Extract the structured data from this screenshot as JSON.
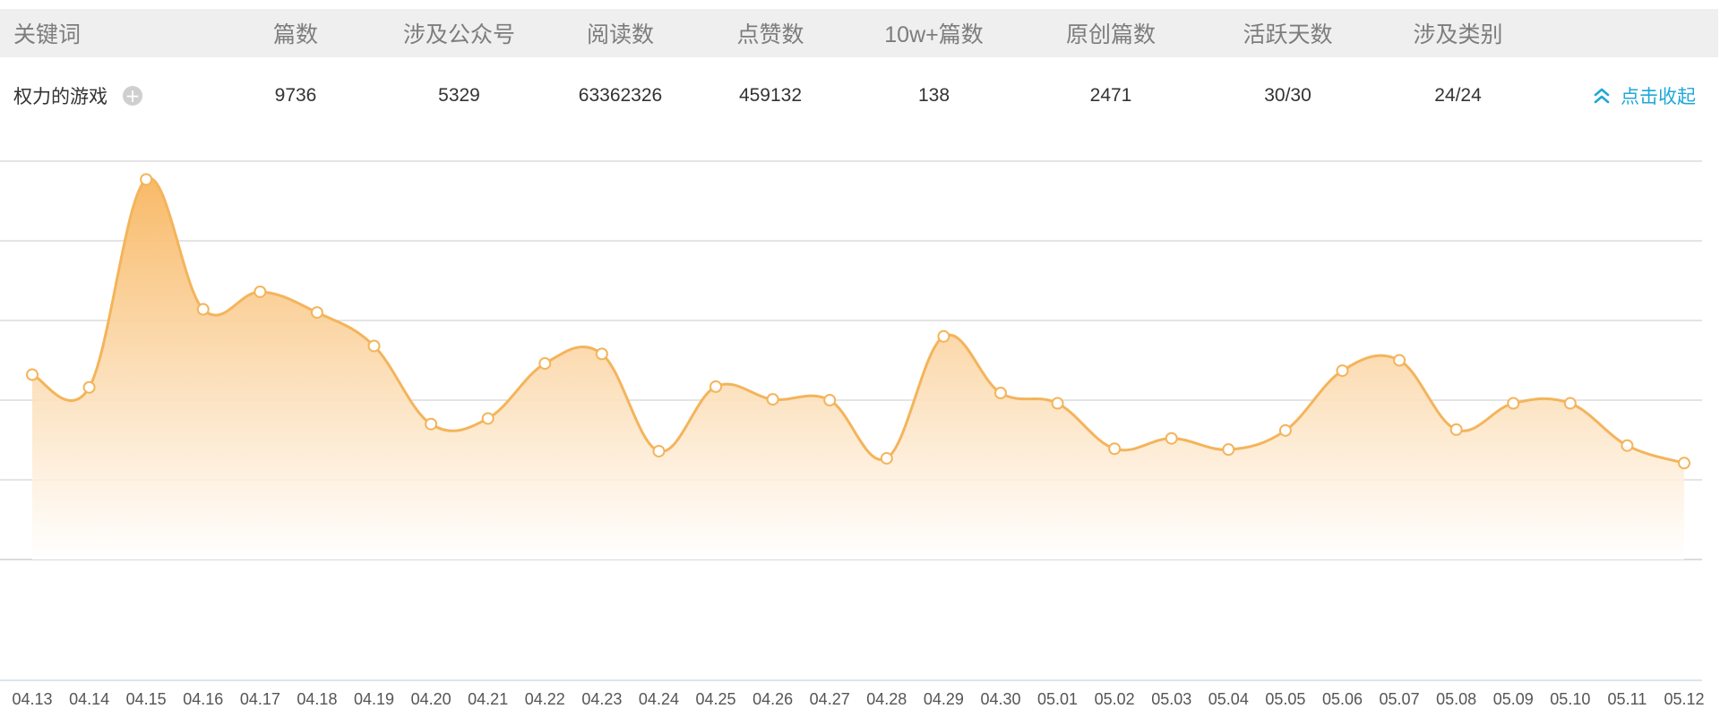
{
  "table": {
    "headers": [
      "关键词",
      "篇数",
      "涉及公众号",
      "阅读数",
      "点赞数",
      "10w+篇数",
      "原创篇数",
      "活跃天数",
      "涉及类别"
    ],
    "row": {
      "keyword": "权力的游戏",
      "articles": "9736",
      "accounts": "5329",
      "reads": "63362326",
      "likes": "459132",
      "over_100k": "138",
      "original": "2471",
      "active_days": "30/30",
      "categories": "24/24",
      "collapse_label": "点击收起"
    }
  },
  "icons": {
    "add": "plus-circle-icon",
    "collapse": "chevron-double-up-icon"
  },
  "colors": {
    "line": "#f4b45b",
    "area_top": "#f8b660",
    "area_bottom": "#ffffff",
    "grid": "#dcdcdc",
    "link": "#1fa7d8"
  },
  "chart_data": {
    "type": "area",
    "title": "",
    "xlabel": "",
    "ylabel": "",
    "grid": true,
    "legend": "none",
    "y_scale": "relative",
    "ylim": [
      0,
      5
    ],
    "x": [
      "04.13",
      "04.14",
      "04.15",
      "04.16",
      "04.17",
      "04.18",
      "04.19",
      "04.20",
      "04.21",
      "04.22",
      "04.23",
      "04.24",
      "04.25",
      "04.26",
      "04.27",
      "04.28",
      "04.29",
      "04.30",
      "05.01",
      "05.02",
      "05.03",
      "05.04",
      "05.05",
      "05.06",
      "05.07",
      "05.08",
      "05.09",
      "05.10",
      "05.11",
      "05.12"
    ],
    "series": [
      {
        "values": [
          2.32,
          2.16,
          4.77,
          3.14,
          3.36,
          3.1,
          2.68,
          1.7,
          1.77,
          2.46,
          2.58,
          1.36,
          2.17,
          2.01,
          2.0,
          1.27,
          2.8,
          2.09,
          1.96,
          1.39,
          1.52,
          1.38,
          1.62,
          2.37,
          2.5,
          1.63,
          1.96,
          1.96,
          1.43,
          1.21
        ]
      }
    ]
  }
}
